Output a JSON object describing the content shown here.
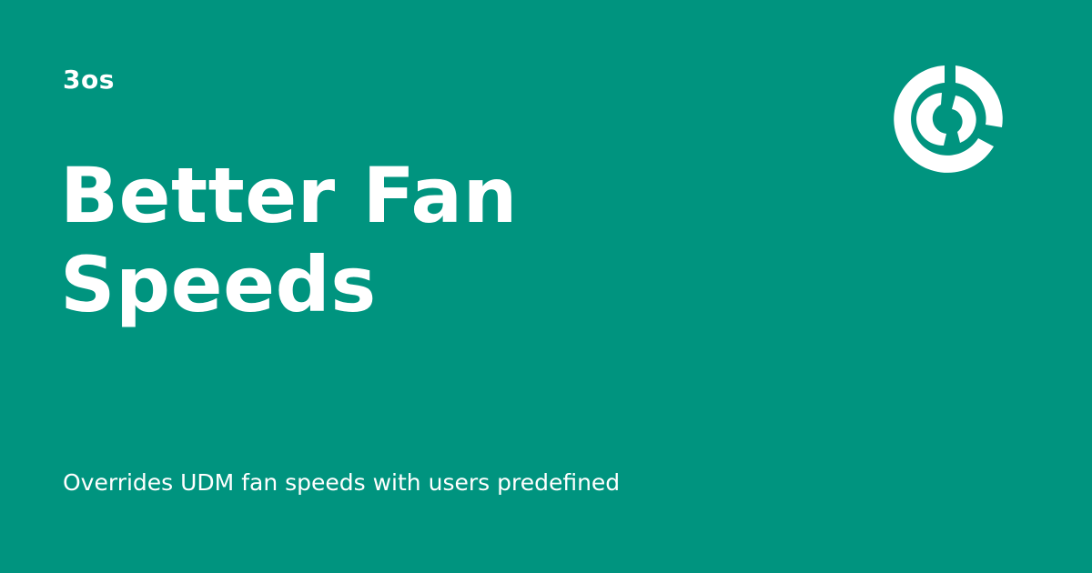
{
  "card": {
    "owner": "3os",
    "title": "Better Fan Speeds",
    "description": "Overrides UDM fan speeds with users predefined",
    "background_color": "#00947f",
    "text_color": "#ffffff",
    "logo_icon": "3os-logo-icon"
  }
}
